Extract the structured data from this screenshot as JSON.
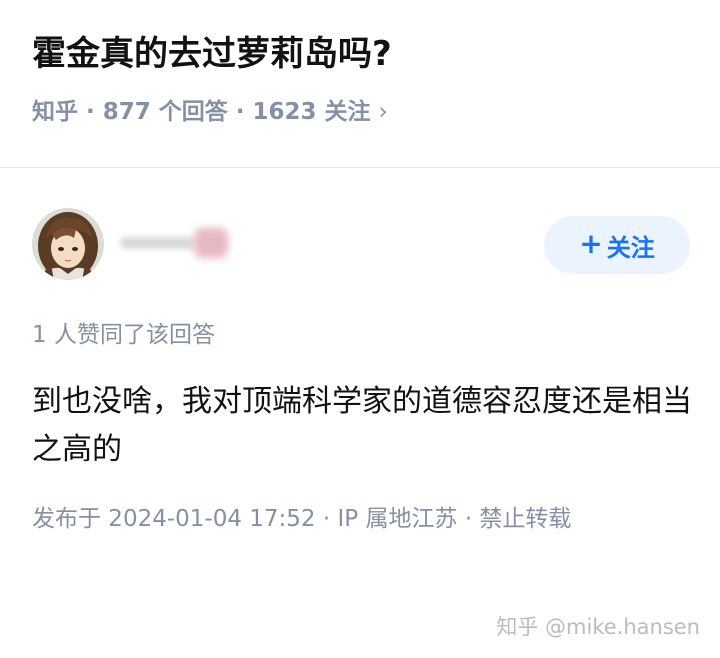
{
  "question": {
    "title": "霍金真的去过萝莉岛吗?",
    "meta": "知乎 · 877 个回答 · 1623 关注",
    "chevron": "›"
  },
  "author": {
    "follow_plus": "+",
    "follow_label": "关注"
  },
  "answer": {
    "likes_text": "1 人赞同了该回答",
    "body": "到也没啥，我对顶端科学家的道德容忍度还是相当之高的",
    "meta": "发布于 2024-01-04 17:52 · IP 属地江苏 · 禁止转载"
  },
  "watermark": "知乎 @mike.hansen",
  "colors": {
    "accent": "#1772f6",
    "follow_bg": "#ebf3ff",
    "secondary_text": "#8590a6",
    "primary_text": "#121212"
  }
}
